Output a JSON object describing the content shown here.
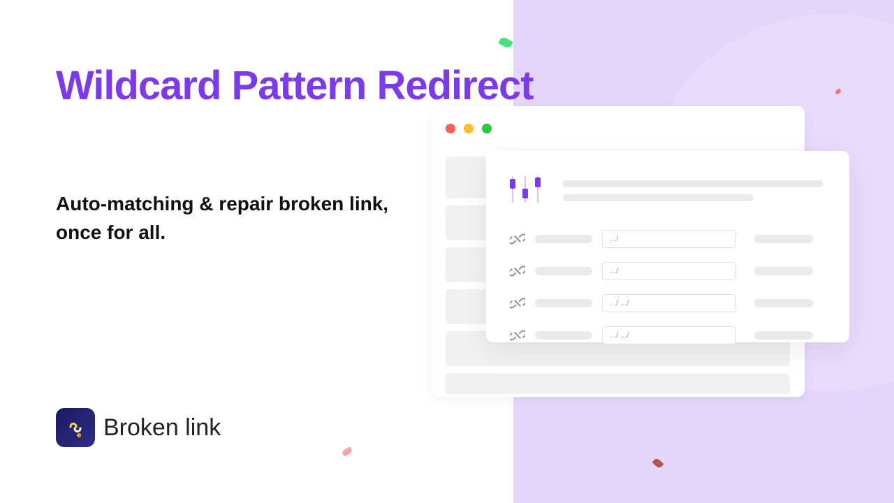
{
  "heading": "Wildcard Pattern Redirect",
  "subheading": "Auto-matching & repair broken link, once for all.",
  "brand": {
    "name": "Broken link"
  },
  "mockup": {
    "rows": [
      {
        "pattern": ".../"
      },
      {
        "pattern": ".../"
      },
      {
        "pattern": ".../ .../"
      },
      {
        "pattern": ".../ .../"
      }
    ]
  }
}
